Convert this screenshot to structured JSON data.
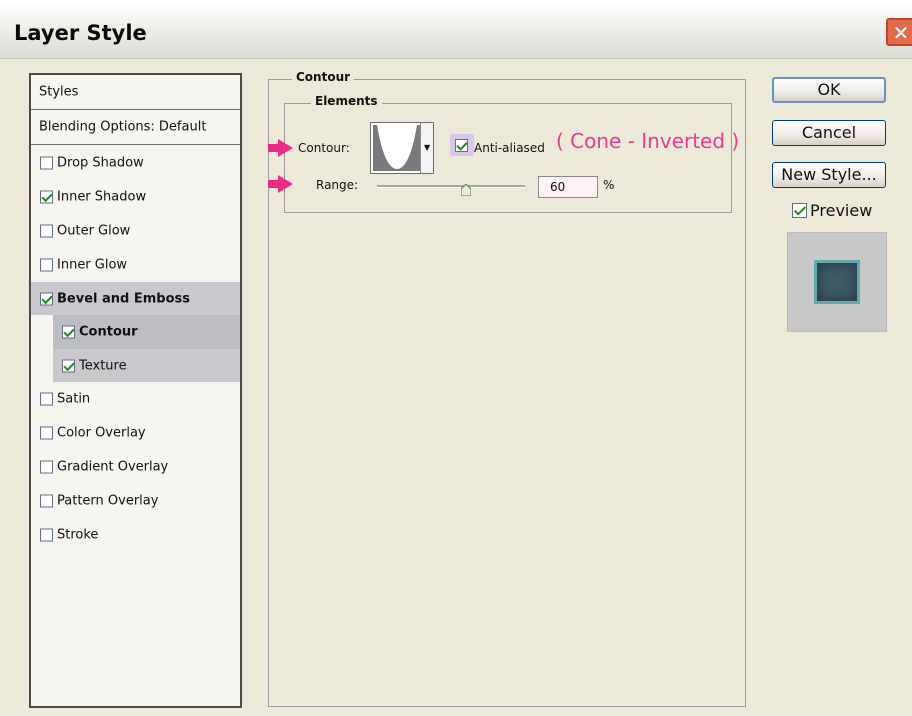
{
  "window": {
    "title": "Layer Style",
    "close_label": "✕"
  },
  "styles_panel": {
    "header": "Styles",
    "blending": "Blending Options: Default",
    "items": [
      {
        "label": "Drop Shadow",
        "checked": false
      },
      {
        "label": "Inner Shadow",
        "checked": true
      },
      {
        "label": "Outer Glow",
        "checked": false
      },
      {
        "label": "Inner Glow",
        "checked": false
      },
      {
        "label": "Bevel and Emboss",
        "checked": true
      },
      {
        "label": "Contour",
        "checked": true
      },
      {
        "label": "Texture",
        "checked": true
      },
      {
        "label": "Satin",
        "checked": false
      },
      {
        "label": "Color Overlay",
        "checked": false
      },
      {
        "label": "Gradient Overlay",
        "checked": false
      },
      {
        "label": "Pattern Overlay",
        "checked": false
      },
      {
        "label": "Stroke",
        "checked": false
      }
    ]
  },
  "contour_section": {
    "group_title": "Contour",
    "sub_title": "Elements",
    "contour_label": "Contour:",
    "anti_aliased_label": "Anti-aliased",
    "anti_aliased_checked": true,
    "annotation": "( Cone - Inverted )",
    "range_label": "Range:",
    "range_value": "60",
    "range_unit": "%"
  },
  "buttons": {
    "ok": "OK",
    "cancel": "Cancel",
    "new_style": "New Style..."
  },
  "preview": {
    "label": "Preview",
    "checked": true
  },
  "colors": {
    "accent_pink": "#ea2c86",
    "annotation_pink": "#e93b8e",
    "selection_gray": "#c9c9cd"
  }
}
